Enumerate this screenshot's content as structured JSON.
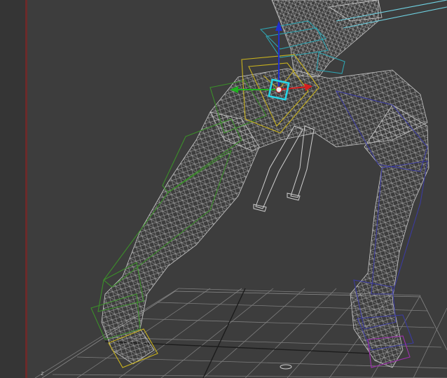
{
  "viewport": {
    "axis_label": "z"
  },
  "colors": {
    "background": "#3d3d3d",
    "grid": "#7a7a7a",
    "wireframe": "#b9b9b9",
    "left_bones": "#3c8f2a",
    "right_bones": "#3b3b9e",
    "spine_bones": "#2fa3b0",
    "pelvis_bones": "#c8b21e",
    "gizmo_x": "#d42020",
    "gizmo_y": "#20b020",
    "gizmo_z": "#2030d0",
    "gizmo_center": "#26d6e8",
    "foot_right_bones": "#a030b0",
    "frame_border": "#6b2a2a"
  },
  "icons": {
    "transform_gizmo": "move-gizmo-icon",
    "pivot": "pivot-icon"
  }
}
